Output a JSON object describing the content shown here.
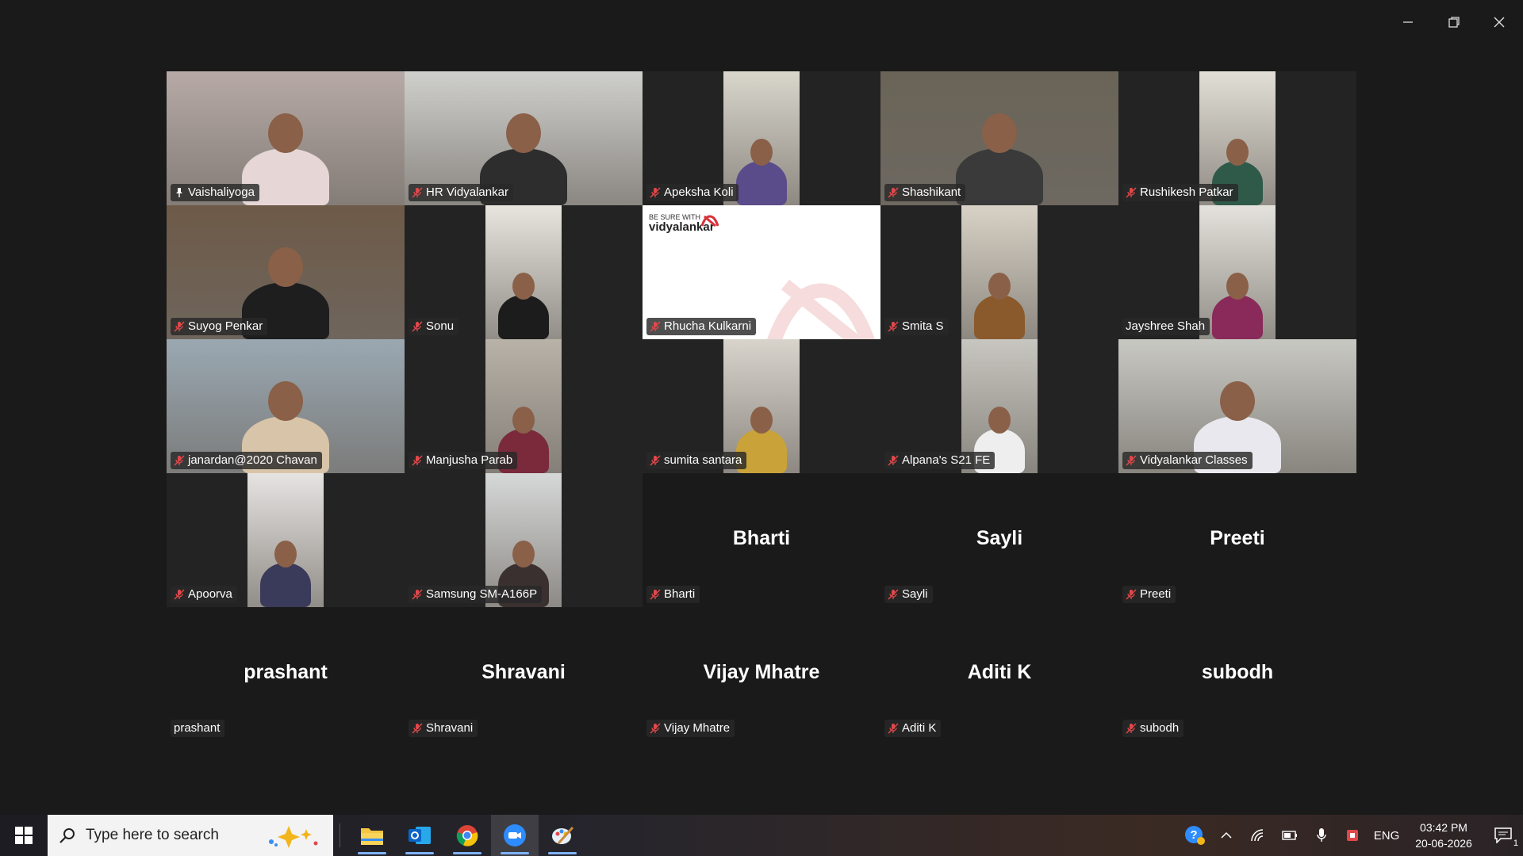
{
  "window": {
    "controls": [
      "minimize",
      "restore",
      "close"
    ]
  },
  "participants": [
    {
      "name": "Vaishaliyoga",
      "video": true,
      "muted": false,
      "pinned": true,
      "active": true,
      "bg": "#b7aaa6",
      "shirt": "#e6d6d6"
    },
    {
      "name": "HR Vidyalankar",
      "video": true,
      "muted": true,
      "bg": "#cfcfcc",
      "shirt": "#2d2d2d"
    },
    {
      "name": "Apeksha Koli",
      "video": true,
      "muted": true,
      "narrow": true,
      "bg": "#d9d6cc",
      "shirt": "#5a4b8a"
    },
    {
      "name": "Shashikant",
      "video": true,
      "muted": true,
      "bg": "#6a6458",
      "shirt": "#3a3a3a"
    },
    {
      "name": "Rushikesh Patkar",
      "video": true,
      "muted": true,
      "narrow": true,
      "bg": "#e2dfd6",
      "shirt": "#2f5a4a"
    },
    {
      "name": "Suyog Penkar",
      "video": true,
      "muted": true,
      "bg": "#6e5a48",
      "shirt": "#1e1e1e"
    },
    {
      "name": "Sonu",
      "video": true,
      "muted": true,
      "narrow": true,
      "bg": "#e8e4de",
      "shirt": "#1c1c1c"
    },
    {
      "name": "Rhucha Kulkarni",
      "video": false,
      "muted": true,
      "slide": true,
      "slide_tagline": "BE SURE WITH",
      "slide_brand": "vidyalankar"
    },
    {
      "name": "Smita S",
      "video": true,
      "muted": true,
      "narrow": true,
      "bg": "#d8d2c6",
      "shirt": "#8a5a2c"
    },
    {
      "name": "Jayshree Shah",
      "video": true,
      "muted": false,
      "nolabelicon": true,
      "narrow": true,
      "bg": "#e4e2dc",
      "shirt": "#8a2a5a"
    },
    {
      "name": "janardan@2020 Chavan",
      "video": true,
      "muted": true,
      "bg": "#9aa8b2",
      "shirt": "#d8c4a8"
    },
    {
      "name": "Manjusha Parab",
      "video": true,
      "muted": true,
      "narrow": true,
      "bg": "#b8b2a8",
      "shirt": "#7a2a3a"
    },
    {
      "name": "sumita santara",
      "video": true,
      "muted": true,
      "narrow": true,
      "bg": "#d8d4cc",
      "shirt": "#c9a23a"
    },
    {
      "name": "Alpana's S21 FE",
      "video": true,
      "muted": true,
      "narrow": true,
      "bg": "#c8c6c0",
      "shirt": "#eeeeee"
    },
    {
      "name": "Vidyalankar Classes",
      "video": true,
      "muted": true,
      "bg": "#c8c8c2",
      "shirt": "#e8e8ee"
    },
    {
      "name": "Apoorva",
      "video": true,
      "muted": true,
      "narrow": true,
      "bg": "#e6e4e2",
      "shirt": "#3a3a5a"
    },
    {
      "name": "Samsung SM-A166P",
      "video": true,
      "muted": true,
      "narrow": true,
      "bg": "#d6d8d8",
      "shirt": "#3a3030"
    },
    {
      "name": "Bharti",
      "video": false,
      "muted": true
    },
    {
      "name": "Sayli",
      "video": false,
      "muted": true
    },
    {
      "name": "Preeti",
      "video": false,
      "muted": true
    },
    {
      "name": "prashant",
      "video": false,
      "muted": false
    },
    {
      "name": "Shravani",
      "video": false,
      "muted": true
    },
    {
      "name": "Vijay Mhatre",
      "video": false,
      "muted": true
    },
    {
      "name": "Aditi K",
      "video": false,
      "muted": true
    },
    {
      "name": "subodh",
      "video": false,
      "muted": true
    }
  ],
  "taskbar": {
    "search_placeholder": "Type here to search",
    "apps": [
      "file-explorer",
      "outlook",
      "chrome",
      "zoom",
      "paint"
    ],
    "active_app": "zoom",
    "language": "ENG",
    "time": "03:42 PM",
    "date": "20-06-2026",
    "notification_count": "1"
  },
  "colors": {
    "active_speaker": "#23d96b",
    "muted_red": "#e0484a",
    "background": "#1a1a1a"
  }
}
